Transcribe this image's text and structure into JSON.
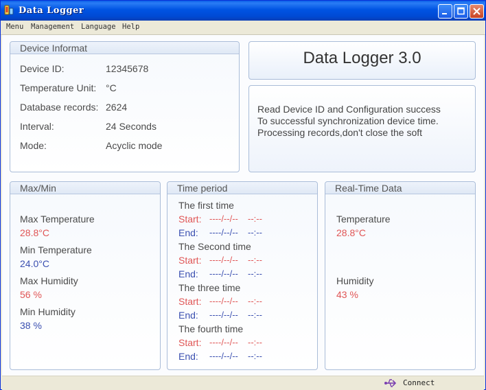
{
  "window": {
    "title": "Data Logger"
  },
  "menu": [
    "Menu",
    "Management",
    "Language",
    "Help"
  ],
  "device": {
    "title": "Device Informat",
    "rows": [
      {
        "label": "Device ID:",
        "value": "12345678"
      },
      {
        "label": "Temperature Unit:",
        "value": "°C"
      },
      {
        "label": "Database records:",
        "value": "2624"
      },
      {
        "label": "Interval:",
        "value": "24 Seconds"
      },
      {
        "label": "Mode:",
        "value": "Acyclic mode"
      }
    ]
  },
  "brand": {
    "title": "Data Logger 3.0"
  },
  "messages": [
    "Read Device ID and Configuration success",
    "To successful synchronization device time.",
    "Processing records,don't close the soft"
  ],
  "maxmin": {
    "title": "Max/Min",
    "items": [
      {
        "label": "Max Temperature",
        "value": "28.8°C",
        "color": "#e05555"
      },
      {
        "label": "Min Temperature",
        "value": "24.0°C",
        "color": "#3a4fb0"
      },
      {
        "label": "Max Humidity",
        "value": "56 %",
        "color": "#e05555"
      },
      {
        "label": "Min Humidity",
        "value": "38 %",
        "color": "#3a4fb0"
      }
    ]
  },
  "period": {
    "title": "Time period",
    "start_label": "Start:",
    "end_label": "End:",
    "blocks": [
      {
        "name": "The first time",
        "start": "----/--/--",
        "start_time": "--:--",
        "end": "----/--/--",
        "end_time": "--:--"
      },
      {
        "name": "The Second time",
        "start": "----/--/--",
        "start_time": "--:--",
        "end": "----/--/--",
        "end_time": "--:--"
      },
      {
        "name": "The three time",
        "start": "----/--/--",
        "start_time": "--:--",
        "end": "----/--/--",
        "end_time": "--:--"
      },
      {
        "name": "The fourth time",
        "start": "----/--/--",
        "start_time": "--:--",
        "end": "----/--/--",
        "end_time": "--:--"
      }
    ]
  },
  "realtime": {
    "title": "Real-Time Data",
    "temperature_label": "Temperature",
    "temperature_value": "28.8°C",
    "humidity_label": "Humidity",
    "humidity_value": "43 %"
  },
  "status": {
    "connection": "Connect"
  }
}
